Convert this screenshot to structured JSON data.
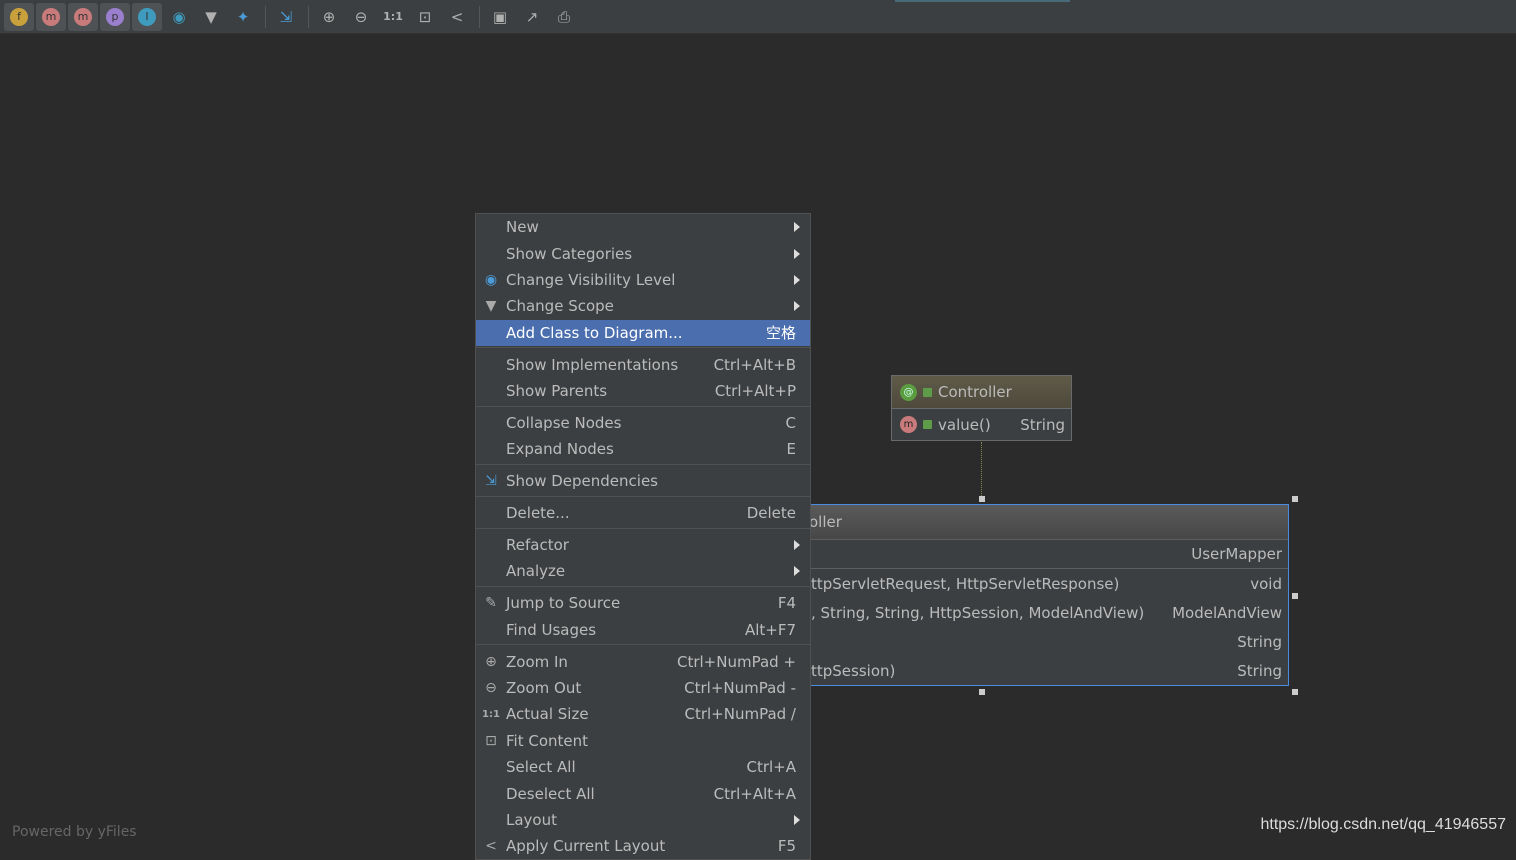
{
  "toolbar": {
    "items": [
      {
        "name": "fields-icon",
        "glyph": "f",
        "color": "#c9a13c",
        "on": true
      },
      {
        "name": "constructors-icon",
        "glyph": "m",
        "color": "#c97b7b",
        "on": true
      },
      {
        "name": "methods-icon",
        "glyph": "m",
        "color": "#c97b7b",
        "on": true
      },
      {
        "name": "properties-icon",
        "glyph": "p",
        "color": "#9b7fcf",
        "on": true
      },
      {
        "name": "inner-classes-icon",
        "glyph": "I",
        "color": "#3f9bbd",
        "on": true
      },
      {
        "name": "visibility-icon",
        "glyph": "◉",
        "color": ""
      },
      {
        "name": "filter-icon",
        "glyph": "▼",
        "color": ""
      },
      {
        "name": "show-dependencies-star-icon",
        "glyph": "✦",
        "color": ""
      },
      {
        "sep": true
      },
      {
        "name": "show-dependencies-icon",
        "glyph": "⇲",
        "color": ""
      },
      {
        "sep": true
      },
      {
        "name": "zoom-in-icon",
        "glyph": "⊕",
        "color": ""
      },
      {
        "name": "zoom-out-icon",
        "glyph": "⊖",
        "color": ""
      },
      {
        "name": "actual-size-icon",
        "glyph": "1:1",
        "color": ""
      },
      {
        "name": "fit-content-icon",
        "glyph": "⊡",
        "color": ""
      },
      {
        "name": "layout-icon",
        "glyph": "<",
        "color": ""
      },
      {
        "sep": true
      },
      {
        "name": "save-icon",
        "glyph": "▣",
        "color": ""
      },
      {
        "name": "export-icon",
        "glyph": "↗",
        "color": ""
      },
      {
        "name": "print-icon",
        "glyph": "⎙",
        "color": ""
      }
    ]
  },
  "menu": [
    {
      "label": "New",
      "arrow": true
    },
    {
      "label": "Show Categories",
      "arrow": true
    },
    {
      "label": "Change Visibility Level",
      "arrow": true,
      "icon": "visibility-icon",
      "glyph": "◉"
    },
    {
      "label": "Change Scope",
      "arrow": true,
      "icon": "filter-icon",
      "glyph": "▼"
    },
    {
      "label": "Add Class to Diagram...",
      "shortcut": "空格",
      "highlight": true,
      "sep": true
    },
    {
      "label": "Show Implementations",
      "shortcut": "Ctrl+Alt+B"
    },
    {
      "label": "Show Parents",
      "shortcut": "Ctrl+Alt+P",
      "sep": true
    },
    {
      "label": "Collapse Nodes",
      "shortcut": "C"
    },
    {
      "label": "Expand Nodes",
      "shortcut": "E",
      "sep": true
    },
    {
      "label": "Show Dependencies",
      "icon": "dependencies-icon",
      "glyph": "⇲",
      "sep": true
    },
    {
      "label": "Delete...",
      "shortcut": "Delete",
      "sep": true
    },
    {
      "label": "Refactor",
      "arrow": true
    },
    {
      "label": "Analyze",
      "arrow": true,
      "sep": true
    },
    {
      "label": "Jump to Source",
      "shortcut": "F4",
      "icon": "edit-icon",
      "glyph": "✎"
    },
    {
      "label": "Find Usages",
      "shortcut": "Alt+F7",
      "sep": true
    },
    {
      "label": "Zoom In",
      "shortcut": "Ctrl+NumPad +",
      "icon": "zoom-in-icon",
      "glyph": "⊕"
    },
    {
      "label": "Zoom Out",
      "shortcut": "Ctrl+NumPad -",
      "icon": "zoom-out-icon",
      "glyph": "⊖"
    },
    {
      "label": "Actual Size",
      "shortcut": "Ctrl+NumPad /",
      "icon": "actual-size-icon",
      "glyph": "1:1"
    },
    {
      "label": "Fit Content",
      "icon": "fit-content-icon",
      "glyph": "⊡"
    },
    {
      "label": "Select All",
      "shortcut": "Ctrl+A"
    },
    {
      "label": "Deselect All",
      "shortcut": "Ctrl+Alt+A"
    },
    {
      "label": "Layout",
      "arrow": true
    },
    {
      "label": "Apply Current Layout",
      "shortcut": "F5",
      "icon": "layout-icon",
      "glyph": "<"
    }
  ],
  "controller_node": {
    "title": "Controller",
    "method": "value()",
    "type": "String"
  },
  "user_controller_node": {
    "title": "oller",
    "rows": [
      {
        "left": "",
        "right": "UserMapper",
        "sep": true
      },
      {
        "left": "ttpServletRequest, HttpServletResponse)",
        "right": "void"
      },
      {
        "left": ", String, String, HttpSession, ModelAndView)",
        "right": "ModelAndView"
      },
      {
        "left": "",
        "right": "String"
      },
      {
        "left": "ttpSession)",
        "right": "String"
      }
    ]
  },
  "footer": {
    "powered": "Powered by yFiles",
    "watermark": "https://blog.csdn.net/qq_41946557"
  }
}
